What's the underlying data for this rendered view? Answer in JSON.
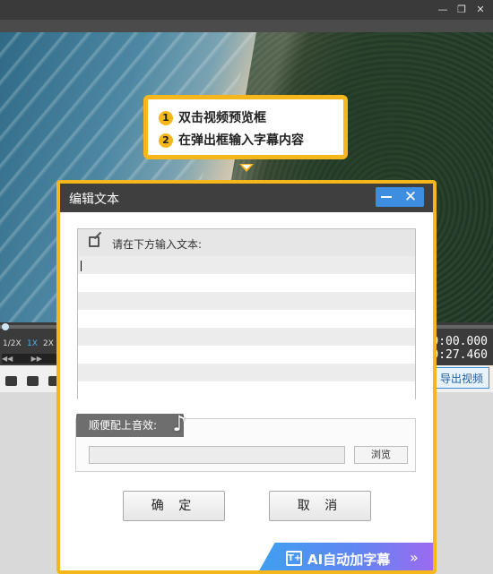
{
  "window": {
    "restore_icon": "restore-icon",
    "close_icon": "close-icon"
  },
  "tooltip": {
    "steps": [
      {
        "num": "1",
        "text": "双击视频预览框"
      },
      {
        "num": "2",
        "text": "在弹出框输入字幕内容"
      }
    ]
  },
  "player": {
    "speeds": [
      "1/2X",
      "1X",
      "2X"
    ],
    "active_speed": "1X",
    "current_time": "0:00.000",
    "total_time": "0:27.460",
    "export_label": "导出视频"
  },
  "dialog": {
    "title": "编辑文本",
    "text_area": {
      "prompt": "请在下方输入文本:",
      "value": ""
    },
    "sound_effect": {
      "label": "顺便配上音效:",
      "value": "",
      "browse_label": "浏览"
    },
    "ok_label": "确 定",
    "cancel_label": "取 消",
    "ai_subtitle_label": "AI自动加字幕",
    "ai_chevron": "»",
    "colors": {
      "accent_orange": "#f5b71c",
      "title_blue": "#3d8ee0"
    }
  }
}
